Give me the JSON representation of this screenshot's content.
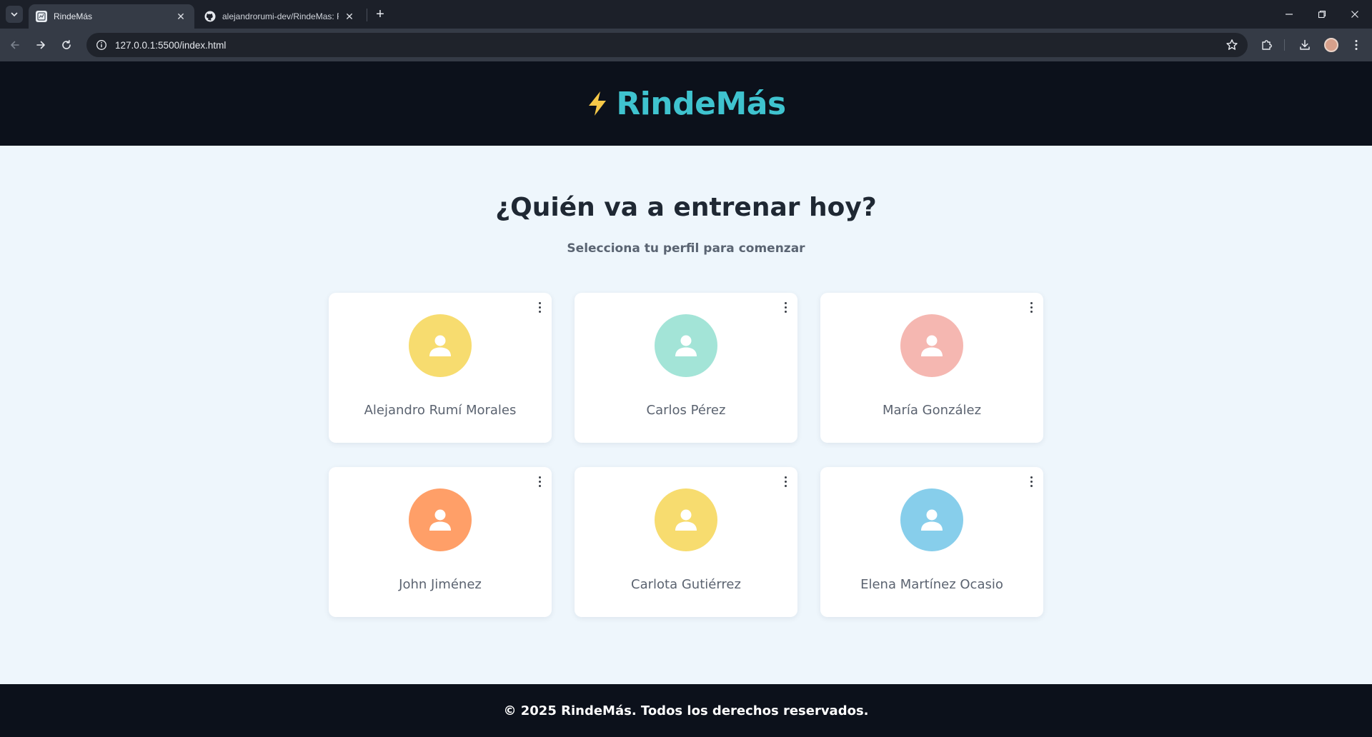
{
  "browser": {
    "tabs": [
      {
        "title": "RindeMás",
        "active": true
      },
      {
        "title": "alejandrorumi-dev/RindeMas: R",
        "active": false
      }
    ],
    "url": "127.0.0.1:5500/index.html",
    "icons": {
      "tab_search": "chevron-down-icon",
      "back": "arrow-left-icon",
      "forward": "arrow-right-icon",
      "reload": "reload-icon",
      "site_info": "info-icon",
      "bookmark": "star-icon",
      "extensions": "puzzle-icon",
      "downloads": "download-icon",
      "menu": "kebab-icon"
    }
  },
  "header": {
    "brand": "RindeMás",
    "logo_icon": "lightning-bolt-icon",
    "brand_color": "#3fc3cf",
    "bolt_color": "#f7c948"
  },
  "main": {
    "title": "¿Quién va a entrenar hoy?",
    "subtitle": "Selecciona tu perfil para comenzar",
    "profiles": [
      {
        "name": "Alejandro Rumí Morales",
        "color": "#f7dc6f"
      },
      {
        "name": "Carlos Pérez",
        "color": "#a3e4d7"
      },
      {
        "name": "María González",
        "color": "#f5b7b1"
      },
      {
        "name": "John Jiménez",
        "color": "#ff9f68"
      },
      {
        "name": "Carlota Gutiérrez",
        "color": "#f7dc6f"
      },
      {
        "name": "Elena Martínez Ocasio",
        "color": "#87ceeb"
      }
    ]
  },
  "footer": {
    "text": "© 2025 RindeMás. Todos los derechos reservados."
  }
}
